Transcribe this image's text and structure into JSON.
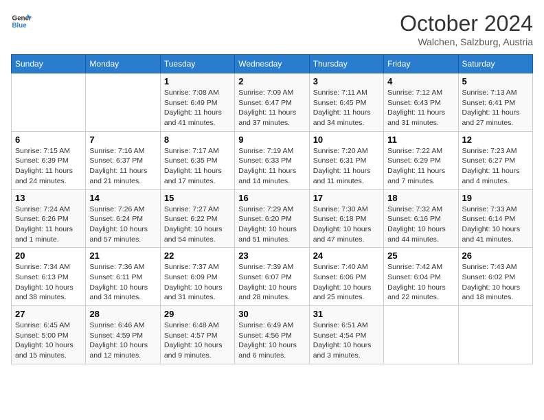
{
  "header": {
    "logo_general": "General",
    "logo_blue": "Blue",
    "month_title": "October 2024",
    "location": "Walchen, Salzburg, Austria"
  },
  "days_of_week": [
    "Sunday",
    "Monday",
    "Tuesday",
    "Wednesday",
    "Thursday",
    "Friday",
    "Saturday"
  ],
  "weeks": [
    [
      {
        "day": null,
        "info": null
      },
      {
        "day": null,
        "info": null
      },
      {
        "day": "1",
        "info": "Sunrise: 7:08 AM\nSunset: 6:49 PM\nDaylight: 11 hours and 41 minutes."
      },
      {
        "day": "2",
        "info": "Sunrise: 7:09 AM\nSunset: 6:47 PM\nDaylight: 11 hours and 37 minutes."
      },
      {
        "day": "3",
        "info": "Sunrise: 7:11 AM\nSunset: 6:45 PM\nDaylight: 11 hours and 34 minutes."
      },
      {
        "day": "4",
        "info": "Sunrise: 7:12 AM\nSunset: 6:43 PM\nDaylight: 11 hours and 31 minutes."
      },
      {
        "day": "5",
        "info": "Sunrise: 7:13 AM\nSunset: 6:41 PM\nDaylight: 11 hours and 27 minutes."
      }
    ],
    [
      {
        "day": "6",
        "info": "Sunrise: 7:15 AM\nSunset: 6:39 PM\nDaylight: 11 hours and 24 minutes."
      },
      {
        "day": "7",
        "info": "Sunrise: 7:16 AM\nSunset: 6:37 PM\nDaylight: 11 hours and 21 minutes."
      },
      {
        "day": "8",
        "info": "Sunrise: 7:17 AM\nSunset: 6:35 PM\nDaylight: 11 hours and 17 minutes."
      },
      {
        "day": "9",
        "info": "Sunrise: 7:19 AM\nSunset: 6:33 PM\nDaylight: 11 hours and 14 minutes."
      },
      {
        "day": "10",
        "info": "Sunrise: 7:20 AM\nSunset: 6:31 PM\nDaylight: 11 hours and 11 minutes."
      },
      {
        "day": "11",
        "info": "Sunrise: 7:22 AM\nSunset: 6:29 PM\nDaylight: 11 hours and 7 minutes."
      },
      {
        "day": "12",
        "info": "Sunrise: 7:23 AM\nSunset: 6:27 PM\nDaylight: 11 hours and 4 minutes."
      }
    ],
    [
      {
        "day": "13",
        "info": "Sunrise: 7:24 AM\nSunset: 6:26 PM\nDaylight: 11 hours and 1 minute."
      },
      {
        "day": "14",
        "info": "Sunrise: 7:26 AM\nSunset: 6:24 PM\nDaylight: 10 hours and 57 minutes."
      },
      {
        "day": "15",
        "info": "Sunrise: 7:27 AM\nSunset: 6:22 PM\nDaylight: 10 hours and 54 minutes."
      },
      {
        "day": "16",
        "info": "Sunrise: 7:29 AM\nSunset: 6:20 PM\nDaylight: 10 hours and 51 minutes."
      },
      {
        "day": "17",
        "info": "Sunrise: 7:30 AM\nSunset: 6:18 PM\nDaylight: 10 hours and 47 minutes."
      },
      {
        "day": "18",
        "info": "Sunrise: 7:32 AM\nSunset: 6:16 PM\nDaylight: 10 hours and 44 minutes."
      },
      {
        "day": "19",
        "info": "Sunrise: 7:33 AM\nSunset: 6:14 PM\nDaylight: 10 hours and 41 minutes."
      }
    ],
    [
      {
        "day": "20",
        "info": "Sunrise: 7:34 AM\nSunset: 6:13 PM\nDaylight: 10 hours and 38 minutes."
      },
      {
        "day": "21",
        "info": "Sunrise: 7:36 AM\nSunset: 6:11 PM\nDaylight: 10 hours and 34 minutes."
      },
      {
        "day": "22",
        "info": "Sunrise: 7:37 AM\nSunset: 6:09 PM\nDaylight: 10 hours and 31 minutes."
      },
      {
        "day": "23",
        "info": "Sunrise: 7:39 AM\nSunset: 6:07 PM\nDaylight: 10 hours and 28 minutes."
      },
      {
        "day": "24",
        "info": "Sunrise: 7:40 AM\nSunset: 6:06 PM\nDaylight: 10 hours and 25 minutes."
      },
      {
        "day": "25",
        "info": "Sunrise: 7:42 AM\nSunset: 6:04 PM\nDaylight: 10 hours and 22 minutes."
      },
      {
        "day": "26",
        "info": "Sunrise: 7:43 AM\nSunset: 6:02 PM\nDaylight: 10 hours and 18 minutes."
      }
    ],
    [
      {
        "day": "27",
        "info": "Sunrise: 6:45 AM\nSunset: 5:00 PM\nDaylight: 10 hours and 15 minutes."
      },
      {
        "day": "28",
        "info": "Sunrise: 6:46 AM\nSunset: 4:59 PM\nDaylight: 10 hours and 12 minutes."
      },
      {
        "day": "29",
        "info": "Sunrise: 6:48 AM\nSunset: 4:57 PM\nDaylight: 10 hours and 9 minutes."
      },
      {
        "day": "30",
        "info": "Sunrise: 6:49 AM\nSunset: 4:56 PM\nDaylight: 10 hours and 6 minutes."
      },
      {
        "day": "31",
        "info": "Sunrise: 6:51 AM\nSunset: 4:54 PM\nDaylight: 10 hours and 3 minutes."
      },
      {
        "day": null,
        "info": null
      },
      {
        "day": null,
        "info": null
      }
    ]
  ]
}
